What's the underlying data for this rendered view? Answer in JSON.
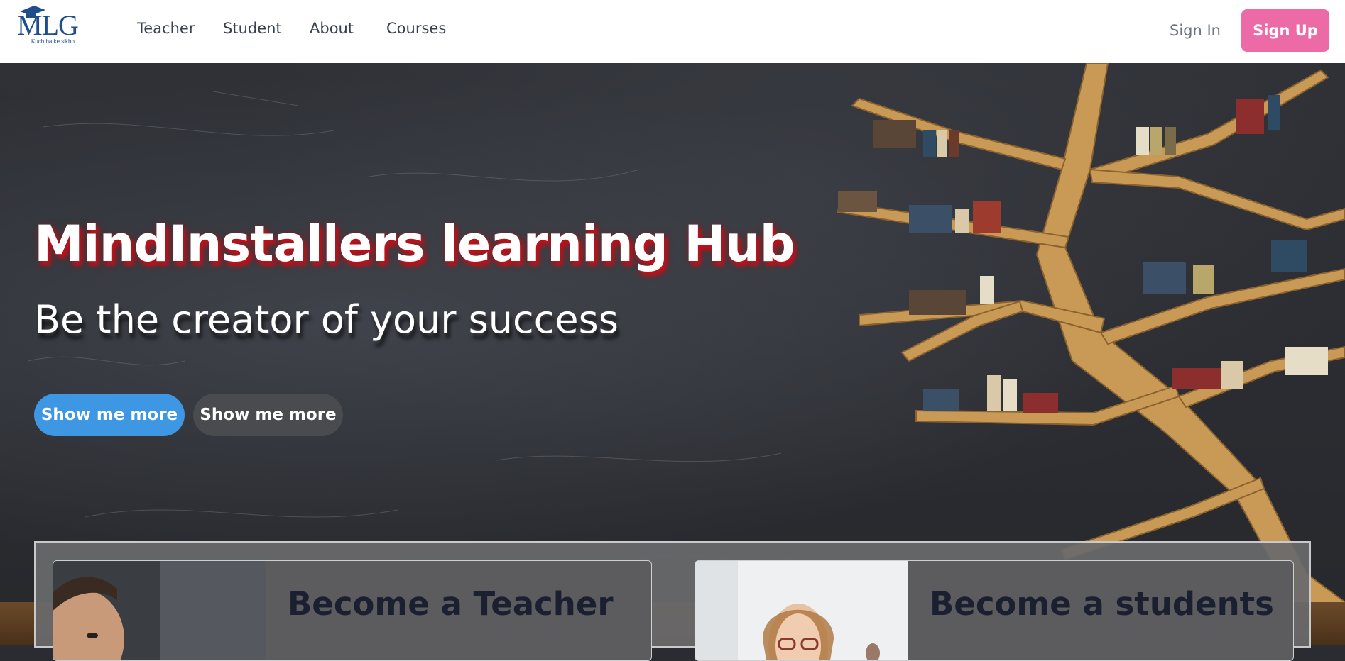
{
  "brand": {
    "logo_text": "MLG",
    "tagline": "Kuch hatke sikho",
    "color": "#1f4e8c"
  },
  "nav": {
    "links": [
      {
        "label": "Teacher"
      },
      {
        "label": "Student"
      },
      {
        "label": "About"
      },
      {
        "label": "Courses"
      }
    ],
    "sign_in": "Sign In",
    "sign_up": "Sign Up",
    "sign_up_color": "#ec6aa6"
  },
  "hero": {
    "title": "MindInstallers learning Hub",
    "subtitle": "Be the creator of your success",
    "primary_button": "Show me more",
    "secondary_button": "Show me more",
    "primary_color": "#3d97e3"
  },
  "cards": [
    {
      "title": "Become a Teacher",
      "image_icon": "teacher-photo"
    },
    {
      "title": "Become a students",
      "image_icon": "student-photo"
    }
  ]
}
